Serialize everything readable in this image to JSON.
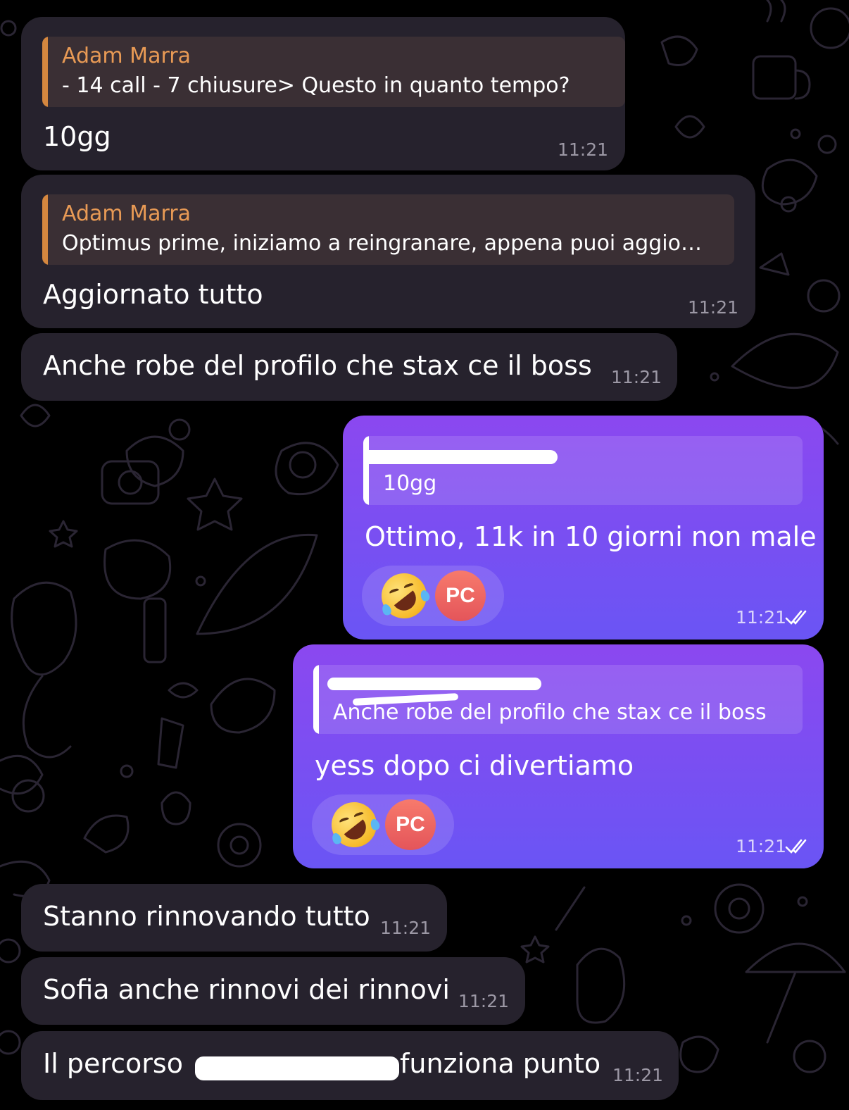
{
  "colors": {
    "background": "#000000",
    "incoming_bubble": "#26222d",
    "outgoing_bubble_top": "#8b48f0",
    "outgoing_bubble_bottom": "#6a55f4",
    "reply_accent": "#e89a55"
  },
  "messages": [
    {
      "direction": "incoming",
      "reply": {
        "name": "Adam Marra",
        "text": "- 14 call - 7 chiusure> Questo in quanto tempo?"
      },
      "text": "10gg",
      "time": "11:21"
    },
    {
      "direction": "incoming",
      "reply": {
        "name": "Adam Marra",
        "text": "Optimus prime, iniziamo a reingranare, appena puoi aggio…"
      },
      "text": "Aggiornato tutto",
      "time": "11:21"
    },
    {
      "direction": "incoming",
      "text": "Anche robe del profilo che stax ce il boss",
      "time": "11:21"
    },
    {
      "direction": "outgoing",
      "reply": {
        "name": "",
        "text": "10gg"
      },
      "text": "Ottimo, 11k in 10 giorni non male",
      "reactions": [
        {
          "icon": "rolling-on-floor-laughing-emoji"
        },
        {
          "avatar": "PC"
        }
      ],
      "time": "11:21",
      "status": "read-double-check-icon"
    },
    {
      "direction": "outgoing",
      "reply": {
        "name": "",
        "text": "Anche robe del profilo che stax ce il boss"
      },
      "text": "yess dopo ci divertiamo",
      "reactions": [
        {
          "icon": "rolling-on-floor-laughing-emoji"
        },
        {
          "avatar": "PC"
        }
      ],
      "time": "11:21",
      "status": "read-double-check-icon"
    },
    {
      "direction": "incoming",
      "text": "Stanno rinnovando tutto",
      "time": "11:21"
    },
    {
      "direction": "incoming",
      "text": "Sofia anche rinnovi dei rinnovi",
      "time": "11:21"
    },
    {
      "direction": "incoming",
      "text_start": "Il percorso",
      "text_end": "funziona punto",
      "time": "11:21"
    }
  ]
}
